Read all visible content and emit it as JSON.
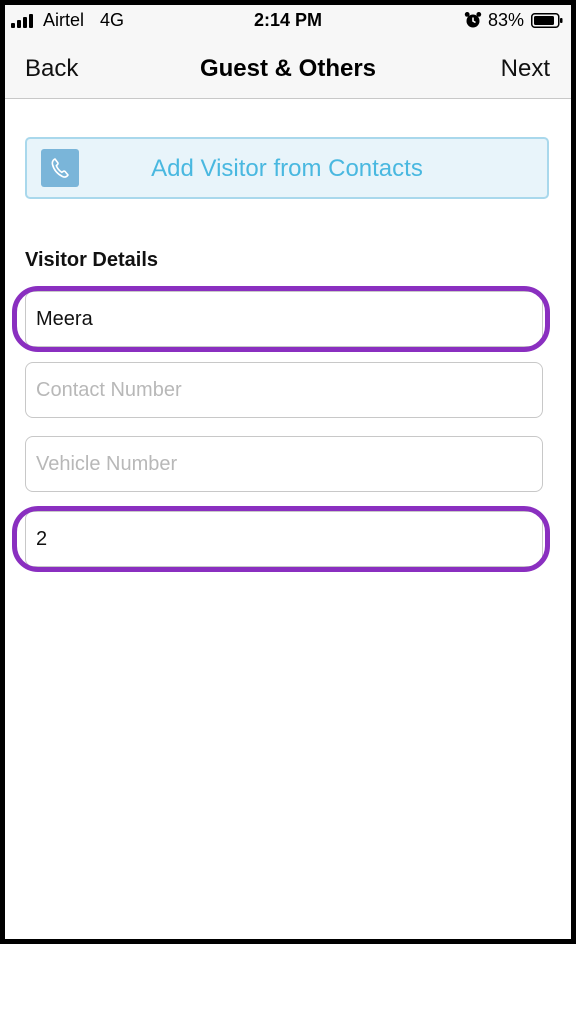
{
  "status_bar": {
    "carrier": "Airtel",
    "network": "4G",
    "time": "2:14 PM",
    "battery_percent": "83%",
    "icons": [
      "signal-icon",
      "alarm-icon",
      "battery-icon"
    ]
  },
  "nav": {
    "back_label": "Back",
    "title": "Guest & Others",
    "next_label": "Next"
  },
  "add_contact": {
    "label": "Add Visitor from Contacts",
    "icon": "phone-icon"
  },
  "visitor_details": {
    "section_label": "Visitor Details",
    "name": {
      "value": "Meera",
      "placeholder": ""
    },
    "contact_number": {
      "value": "",
      "placeholder": "Contact Number"
    },
    "vehicle_number": {
      "value": "",
      "placeholder": "Vehicle Number"
    },
    "visitor_count": {
      "value": "2",
      "placeholder": ""
    }
  },
  "colors": {
    "accent": "#49b8e0",
    "button_bg": "#e8f4fa",
    "button_border": "#a9d8ec",
    "phone_icon_bg": "#7ab5d9",
    "highlight": "#8a2fc0",
    "bar_bg": "#f7f7f7"
  }
}
